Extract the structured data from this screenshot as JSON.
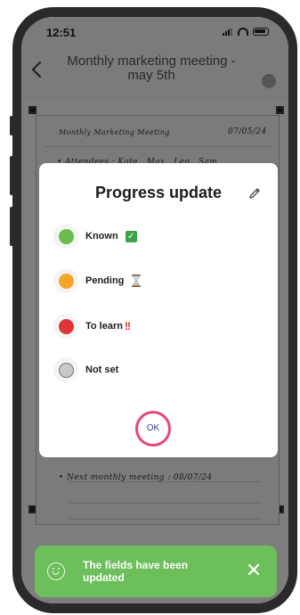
{
  "status_bar": {
    "time": "12:51"
  },
  "header": {
    "title": "Monthly marketing meeting - may 5th"
  },
  "note": {
    "heading": "Monthly Marketing Meeting",
    "date": "07/05/24",
    "attendees": "• Attendees : Kate , Max , Leo , Sam",
    "next_meeting": "• Next monthly meeting : 08/07/24"
  },
  "modal": {
    "title": "Progress update",
    "options": [
      {
        "label": "Known",
        "color": "#6bbd4f",
        "emoji": "✅"
      },
      {
        "label": "Pending",
        "color": "#f5a52a",
        "emoji": "⏳"
      },
      {
        "label": "To learn",
        "color": "#de3535",
        "emoji": "‼️"
      },
      {
        "label": "Not set",
        "color": "#c8c8c8",
        "emoji": ""
      }
    ],
    "ok_label": "OK"
  },
  "toast": {
    "message": "The fields have been updated",
    "color": "#6cbf5a"
  }
}
